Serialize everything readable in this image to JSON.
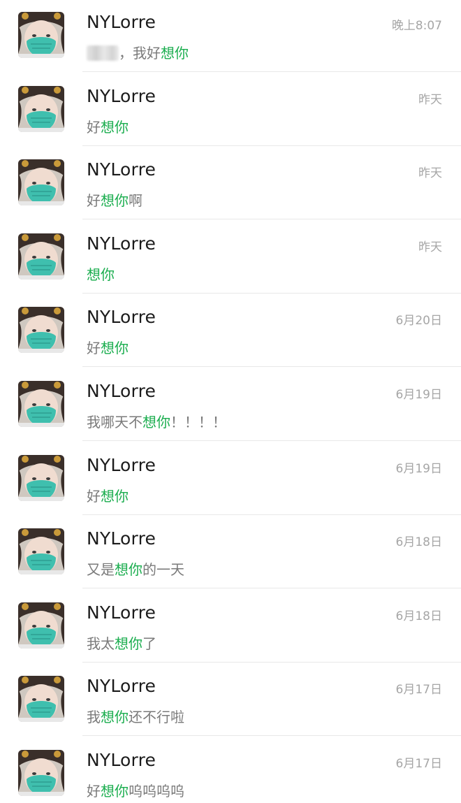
{
  "chats": [
    {
      "name": "NYLorre",
      "time": "晚上8:07",
      "pre": "，我好",
      "hl": "想你",
      "post": "",
      "redacted": true
    },
    {
      "name": "NYLorre",
      "time": "昨天",
      "pre": "好",
      "hl": "想你",
      "post": ""
    },
    {
      "name": "NYLorre",
      "time": "昨天",
      "pre": "好",
      "hl": "想你",
      "post": "啊"
    },
    {
      "name": "NYLorre",
      "time": "昨天",
      "pre": "",
      "hl": "想你",
      "post": ""
    },
    {
      "name": "NYLorre",
      "time": "6月20日",
      "pre": "好",
      "hl": "想你",
      "post": ""
    },
    {
      "name": "NYLorre",
      "time": "6月19日",
      "pre": "我哪天不",
      "hl": "想你",
      "post": "！！！！"
    },
    {
      "name": "NYLorre",
      "time": "6月19日",
      "pre": "好",
      "hl": "想你",
      "post": ""
    },
    {
      "name": "NYLorre",
      "time": "6月18日",
      "pre": "又是",
      "hl": "想你",
      "post": "的一天"
    },
    {
      "name": "NYLorre",
      "time": "6月18日",
      "pre": "我太",
      "hl": "想你",
      "post": "了"
    },
    {
      "name": "NYLorre",
      "time": "6月17日",
      "pre": "我",
      "hl": "想你",
      "post": "还不行啦"
    },
    {
      "name": "NYLorre",
      "time": "6月17日",
      "pre": "好",
      "hl": "想你",
      "post": "呜呜呜呜"
    }
  ],
  "colors": {
    "highlight": "#1aad4e",
    "name": "#1c1c1c",
    "time": "#a6a6a6",
    "message": "#7a7a7a"
  },
  "icons": {
    "avatar": "profile-photo-masked-person",
    "redaction": "blurred-text"
  }
}
